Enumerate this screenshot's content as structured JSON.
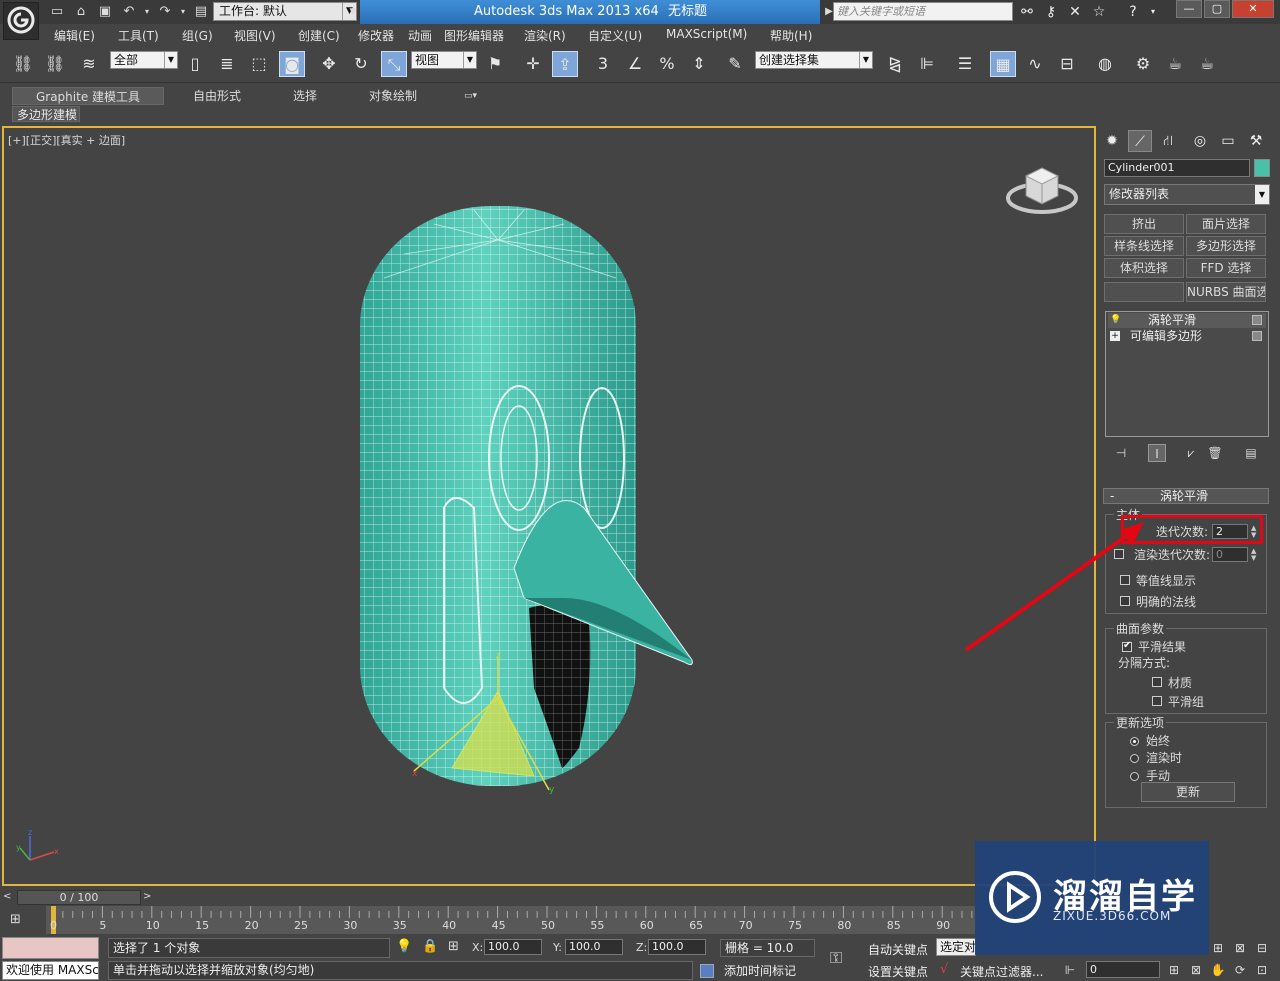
{
  "titlebar": {
    "workspace": "工作台: 默认",
    "app_title": "Autodesk 3ds Max  2013 x64",
    "doc_title": "无标题",
    "search_placeholder": "键入关键字或短语"
  },
  "menu": [
    "编辑(E)",
    "工具(T)",
    "组(G)",
    "视图(V)",
    "创建(C)",
    "修改器",
    "动画",
    "图形编辑器",
    "渲染(R)",
    "自定义(U)",
    "MAXScript(M)",
    "帮助(H)"
  ],
  "toolbar": {
    "selection_filter": "全部",
    "ref_coord": "视图",
    "named_selection": "创建选择集"
  },
  "ribbon": {
    "tabs": [
      "Graphite 建模工具",
      "自由形式",
      "选择",
      "对象绘制"
    ],
    "subpanel": "多边形建模"
  },
  "viewport": {
    "label": "[+][正交][真实 + 边面]"
  },
  "command_panel": {
    "object_name": "Cylinder001",
    "object_color": "#48c1a8",
    "modifier_list": "修改器列表",
    "modifier_buttons": [
      "挤出",
      "面片选择",
      "样条线选择",
      "多边形选择",
      "体积选择",
      "FFD 选择",
      "",
      "NURBS 曲面选择"
    ],
    "stack": [
      {
        "label": "涡轮平滑",
        "icon": "light-bulb-icon"
      },
      {
        "label": "可编辑多边形",
        "icon": "expand-plus-icon"
      }
    ],
    "rollout_title": "涡轮平滑",
    "main_group": "主体",
    "iterations_label": "迭代次数:",
    "iterations_value": "2",
    "render_iters_label": "渲染迭代次数:",
    "render_iters_value": "0",
    "isoline_label": "等值线显示",
    "explicit_normals_label": "明确的法线",
    "surface_group": "曲面参数",
    "smooth_result_label": "平滑结果",
    "separate_by_label": "分隔方式:",
    "materials_label": "材质",
    "smoothing_groups_label": "平滑组",
    "update_group": "更新选项",
    "always_label": "始终",
    "when_rendering_label": "渲染时",
    "manually_label": "手动",
    "update_button": "更新"
  },
  "timeline": {
    "frame_display": "0 / 100",
    "ticks": [
      "0",
      "5",
      "10",
      "15",
      "20",
      "25",
      "30",
      "35",
      "40",
      "45",
      "50",
      "55",
      "60",
      "65",
      "70",
      "75",
      "80",
      "85",
      "90"
    ]
  },
  "status": {
    "welcome": "欢迎使用 MAXScri",
    "selected": "选择了 1 个对象",
    "prompt": "单击并拖动以选择并缩放对象(均匀地)",
    "x_label": "X:",
    "x_value": "100.0",
    "y_label": "Y:",
    "y_value": "100.0",
    "z_label": "Z:",
    "z_value": "100.0",
    "grid": "栅格 = 10.0",
    "add_time_tag": "添加时间标记",
    "auto_key": "自动关键点",
    "set_key": "设置关键点",
    "selected_set": "选定对",
    "key_filters": "关键点过滤器...",
    "frame": "0"
  },
  "watermark": {
    "title": "溜溜自学",
    "url": "ZIXUE.3D66.COM"
  }
}
